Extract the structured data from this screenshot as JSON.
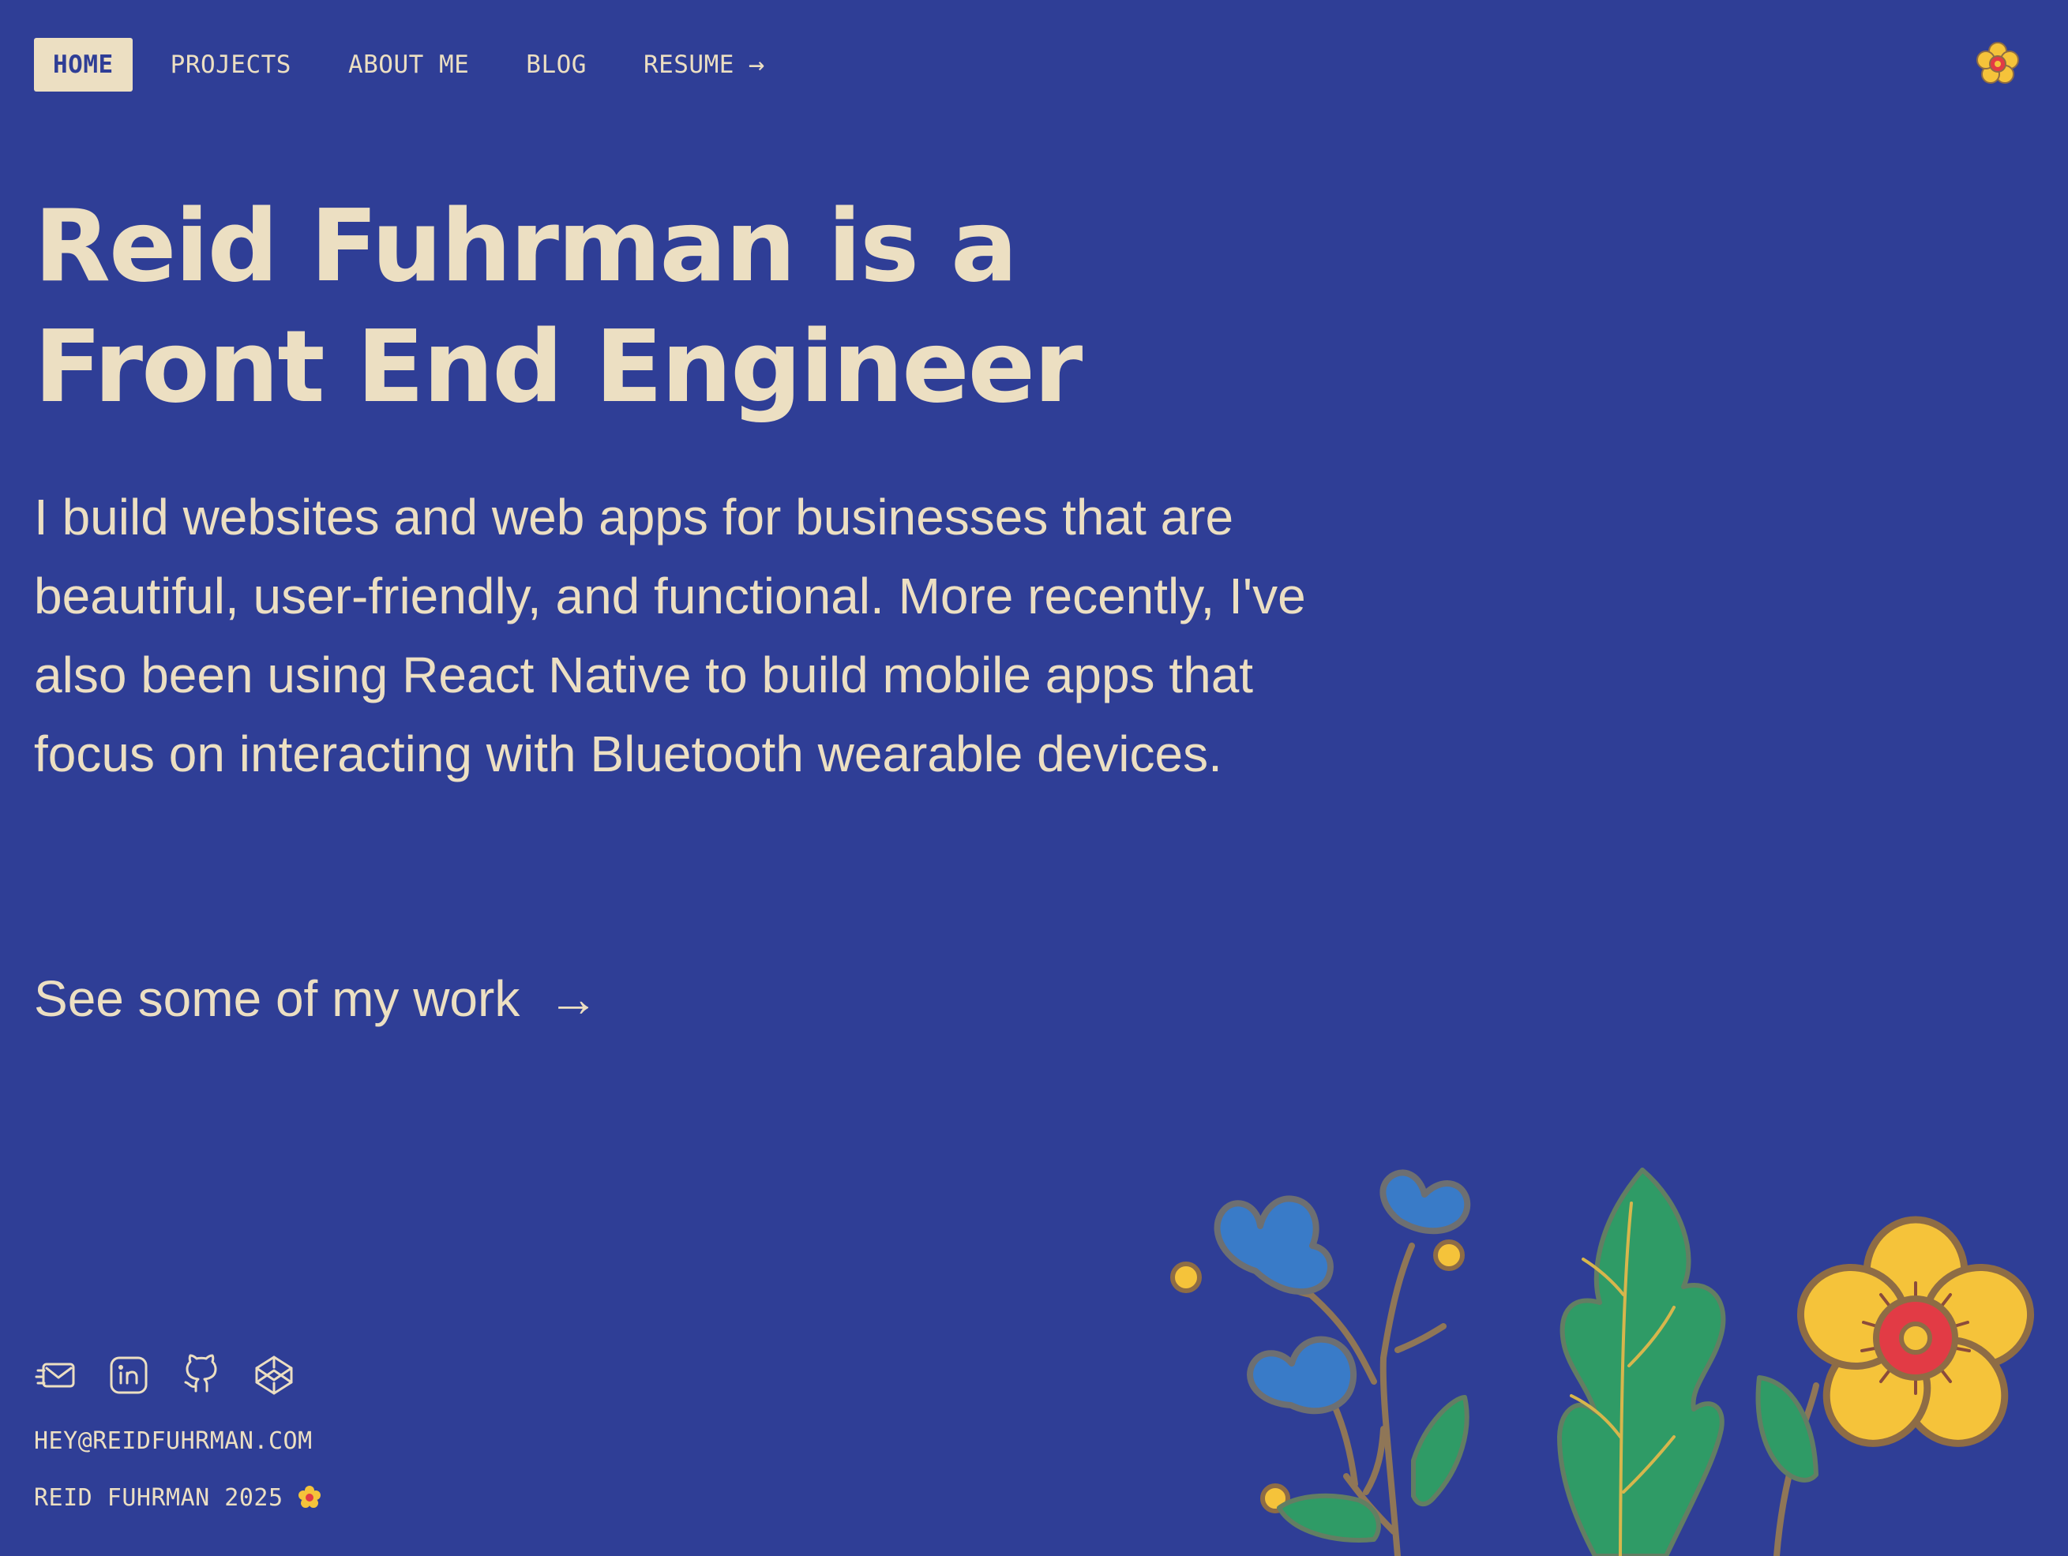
{
  "nav": {
    "items": [
      {
        "label": "HOME",
        "active": true
      },
      {
        "label": "PROJECTS",
        "active": false
      },
      {
        "label": "ABOUT ME",
        "active": false
      },
      {
        "label": "BLOG",
        "active": false
      },
      {
        "label": "RESUME",
        "active": false,
        "trailing": "→"
      }
    ]
  },
  "hero": {
    "title_line1": "Reid Fuhrman is a",
    "title_line2": "Front End Engineer",
    "intro": "I build websites and web apps for businesses that are beautiful, user-friendly, and functional. More recently, I've also been using React Native to build mobile apps that focus on interacting with Bluetooth wearable devices.",
    "cta": "See some of my work",
    "cta_arrow": "→"
  },
  "footer": {
    "email": "HEY@REIDFUHRMAN.COM",
    "copyright": "REID FUHRMAN 2025"
  },
  "icons": {
    "top": "flower-icon",
    "social": [
      "email-icon",
      "linkedin-icon",
      "github-icon",
      "codepen-icon"
    ],
    "copyright": "flower-icon"
  },
  "colors": {
    "background": "#2f3e96",
    "text": "#ecdfc2",
    "active_nav_background": "#ecdfc2",
    "active_nav_text": "#2f3e96",
    "flower_yellow": "#f5c33a",
    "flower_red": "#e23b45",
    "blue_flower": "#397bc8",
    "leaf_green": "#2f9b66"
  }
}
